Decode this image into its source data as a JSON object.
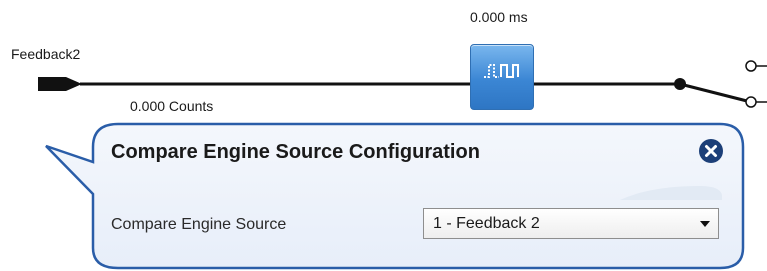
{
  "diagram": {
    "time_readout": "0.000 ms",
    "signal_name": "Feedback2",
    "counts_readout": "0.000 Counts",
    "block_icon": "pulse-waveform-icon"
  },
  "popup": {
    "title": "Compare Engine Source Configuration",
    "close_icon": "close-icon",
    "field_label": "Compare Engine Source",
    "select_value": "1 - Feedback 2",
    "select_arrow_icon": "chevron-down-icon"
  },
  "colors": {
    "block_fill": "#3b86d4",
    "popup_border": "#2a5da8",
    "popup_bg": "#eef3fb",
    "close_button": "#1c3f78"
  }
}
